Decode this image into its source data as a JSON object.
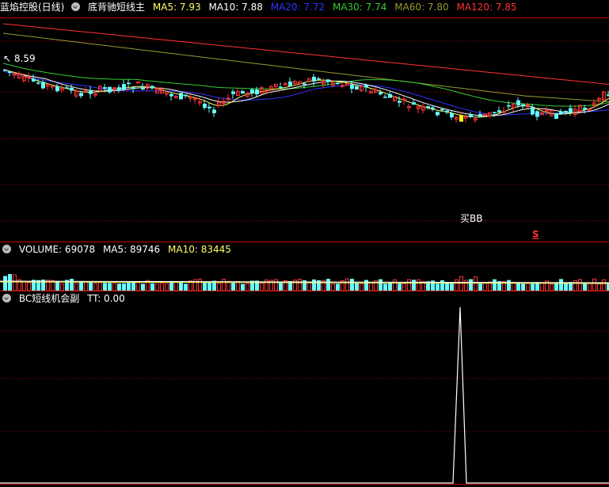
{
  "main_panel": {
    "stock_name": "蓝焰控股(日线)",
    "indicator_name": "底背驰短线主",
    "ma5": {
      "label": "MA5: 7.93",
      "color": "#ffff66"
    },
    "ma10": {
      "label": "MA10: 7.88",
      "color": "#ffffff"
    },
    "ma20": {
      "label": "MA20: 7.72",
      "color": "#3333ff"
    },
    "ma30": {
      "label": "MA30: 7.74",
      "color": "#33cc33"
    },
    "ma60": {
      "label": "MA60: 7.80",
      "color": "#999933"
    },
    "ma120": {
      "label": "MA120: 7.85",
      "color": "#ff3333"
    },
    "high_price_label": "8.59",
    "buy_signal_label": "买BB",
    "signal_marker": "S"
  },
  "volume_panel": {
    "title": "VOLUME: 69078",
    "ma5": {
      "label": "MA5: 89746",
      "color": "#ffffff"
    },
    "ma10": {
      "label": "MA10: 83445",
      "color": "#ffff66"
    }
  },
  "indicator_panel": {
    "title": "BC短线机会副",
    "tt": "TT: 0.00"
  },
  "colors": {
    "up": "#ff3333",
    "down": "#66ffff",
    "grid": "#c00000"
  }
}
